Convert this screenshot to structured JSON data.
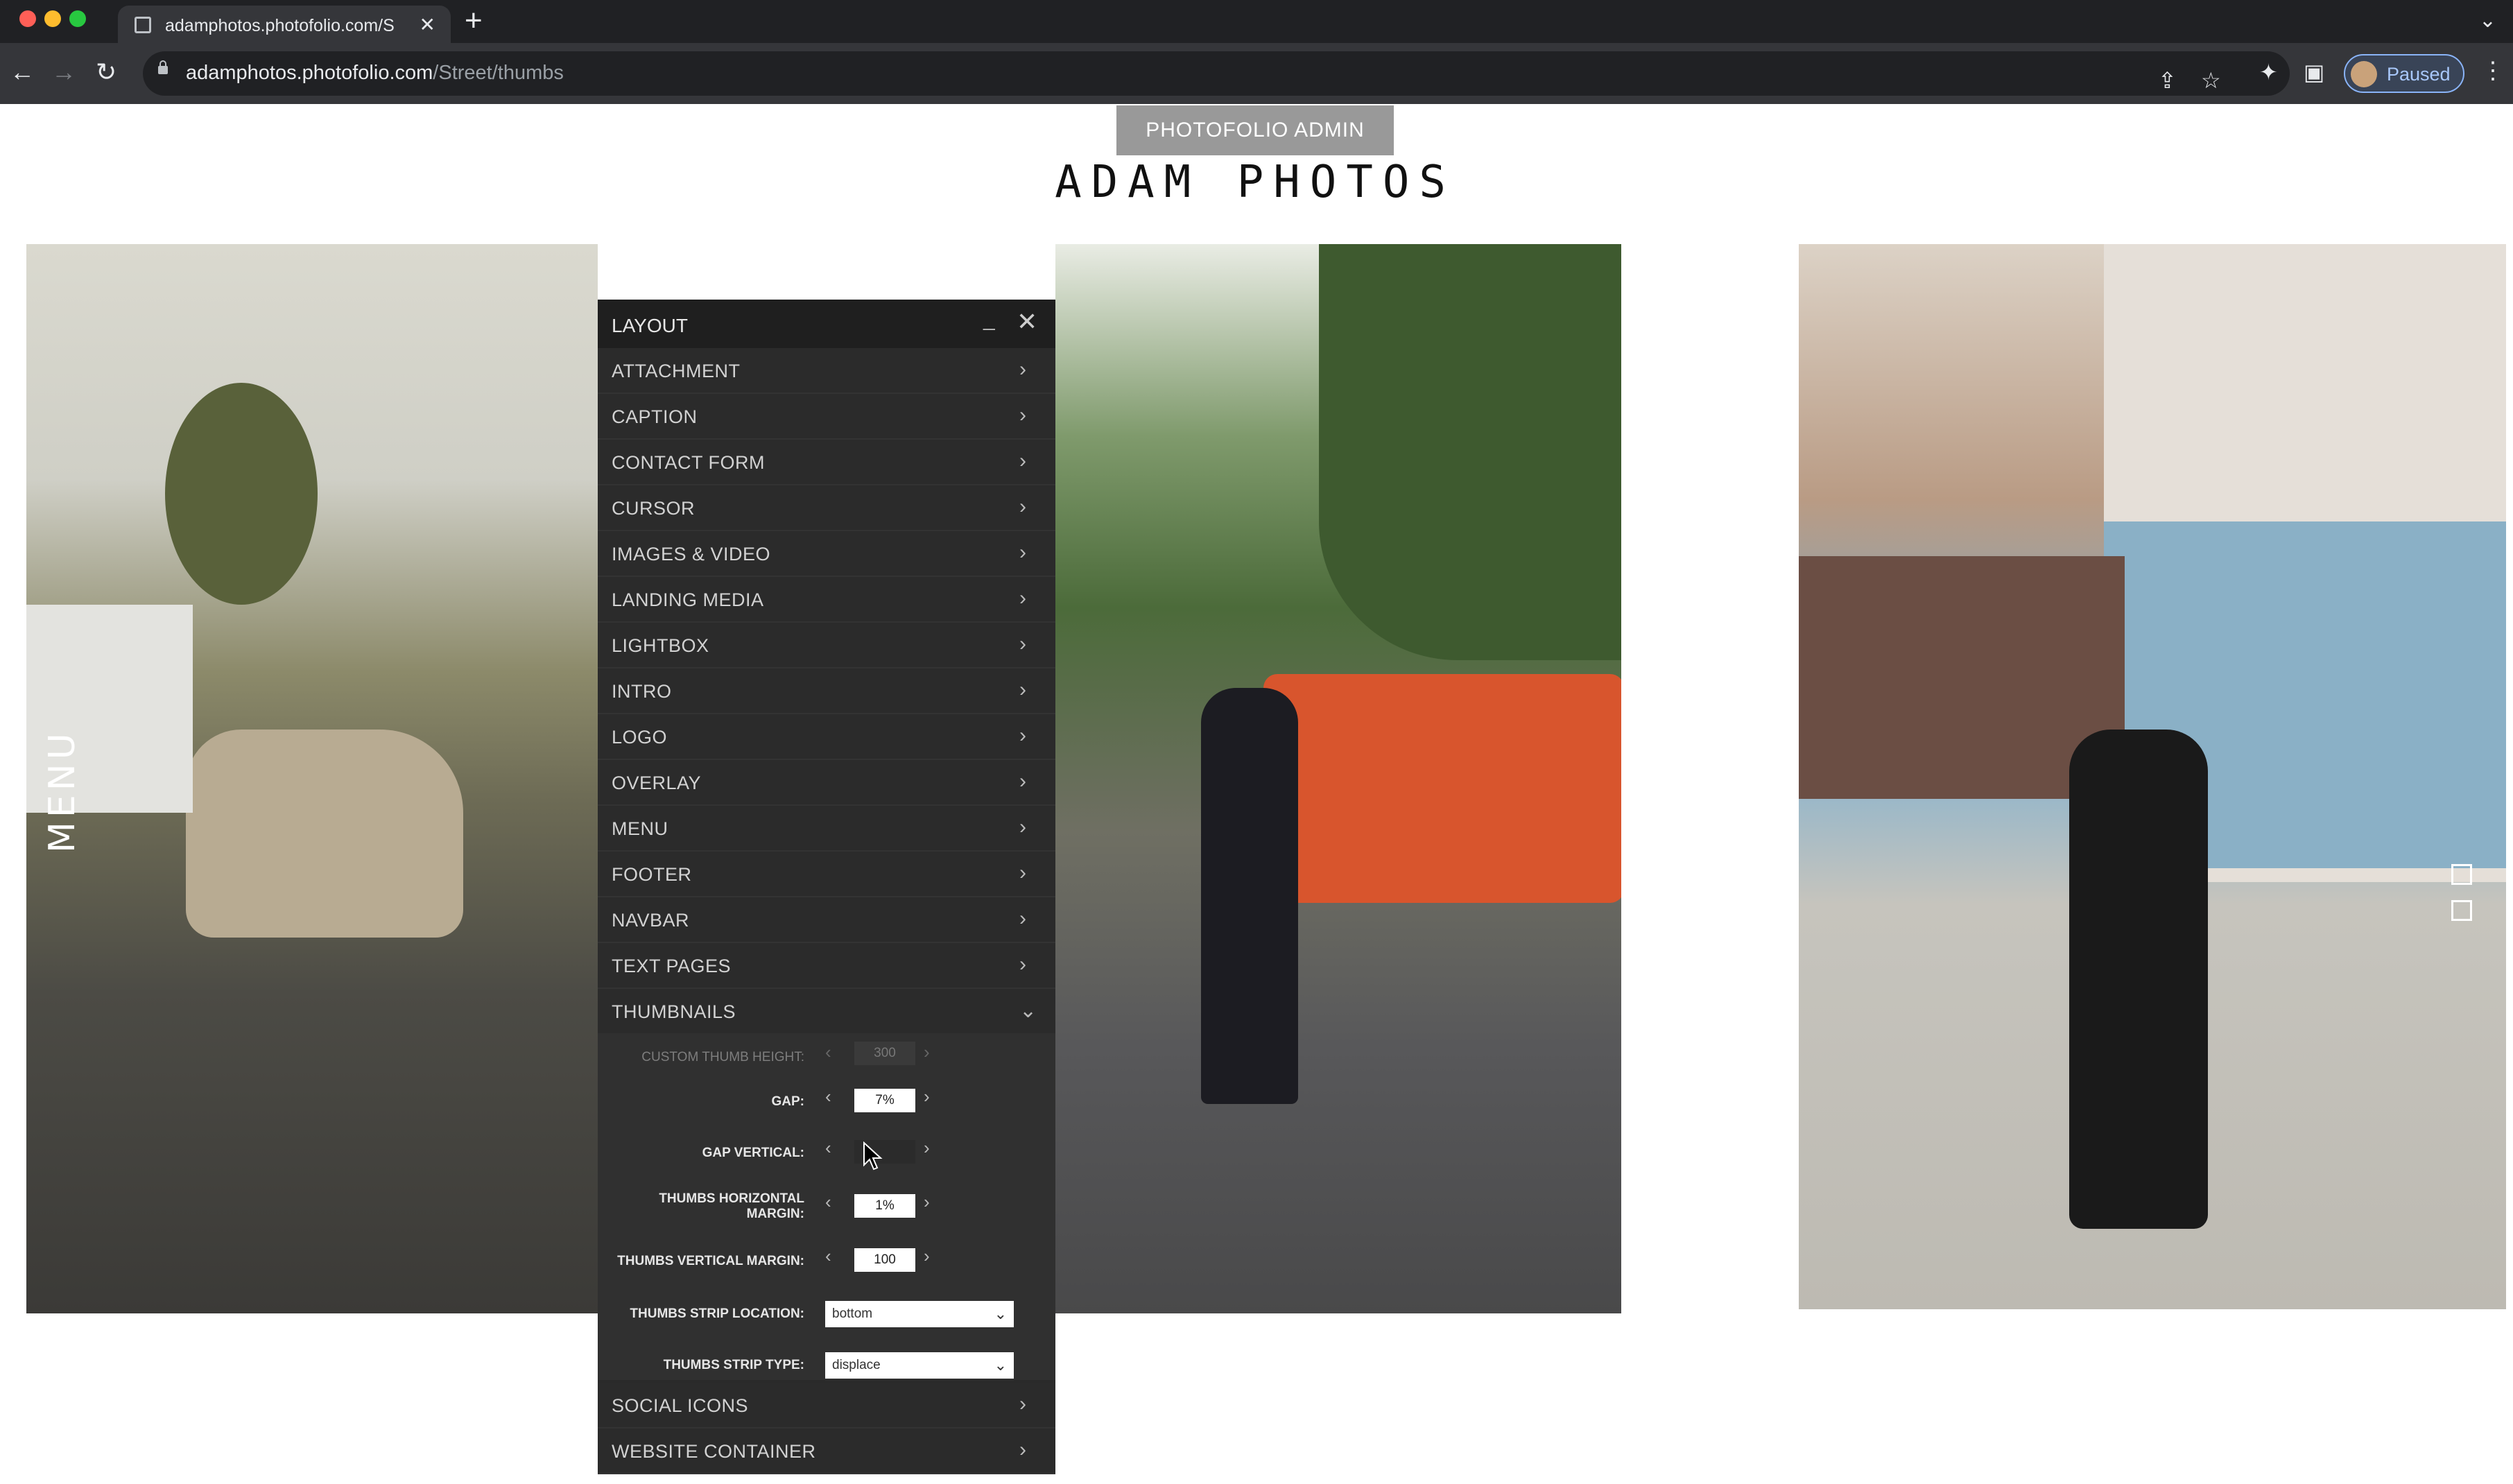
{
  "browser": {
    "tab_title": "adamphotos.photofolio.com/S",
    "url_host": "adamphotos.photofolio.com",
    "url_path": "/Street/thumbs",
    "profile_status": "Paused",
    "icons": [
      "back-arrow-icon",
      "forward-arrow-icon",
      "reload-icon",
      "lock-icon",
      "share-icon",
      "star-icon",
      "extensions-icon",
      "sidebar-icon",
      "kebab-menu-icon"
    ]
  },
  "page": {
    "admin_button": "PHOTOFOLIO ADMIN",
    "site_title": "ADAM PHOTOS",
    "menu_label": "MENU"
  },
  "panel": {
    "title": "LAYOUT",
    "sections": [
      {
        "label": "ATTACHMENT"
      },
      {
        "label": "CAPTION"
      },
      {
        "label": "CONTACT FORM"
      },
      {
        "label": "CURSOR"
      },
      {
        "label": "IMAGES & VIDEO"
      },
      {
        "label": "LANDING MEDIA"
      },
      {
        "label": "LIGHTBOX"
      },
      {
        "label": "INTRO"
      },
      {
        "label": "LOGO"
      },
      {
        "label": "OVERLAY"
      },
      {
        "label": "MENU"
      },
      {
        "label": "FOOTER"
      },
      {
        "label": "NAVBAR"
      },
      {
        "label": "TEXT PAGES"
      },
      {
        "label": "THUMBNAILS",
        "expanded": true
      }
    ],
    "thumbnails": {
      "custom_thumb_height_label": "CUSTOM THUMB HEIGHT:",
      "custom_thumb_height_value": "300",
      "gap_label": "GAP:",
      "gap_value": "7%",
      "gap_vertical_label": "GAP VERTICAL:",
      "gap_vertical_value": "",
      "thumbs_h_margin_label": "THUMBS HORIZONTAL MARGIN:",
      "thumbs_h_margin_value": "1%",
      "thumbs_v_margin_label": "THUMBS VERTICAL MARGIN:",
      "thumbs_v_margin_value": "100",
      "strip_location_label": "THUMBS STRIP LOCATION:",
      "strip_location_value": "bottom",
      "strip_type_label": "THUMBS STRIP TYPE:",
      "strip_type_value": "displace"
    },
    "trailing_sections": [
      {
        "label": "SOCIAL ICONS"
      },
      {
        "label": "WEBSITE CONTAINER"
      }
    ]
  }
}
